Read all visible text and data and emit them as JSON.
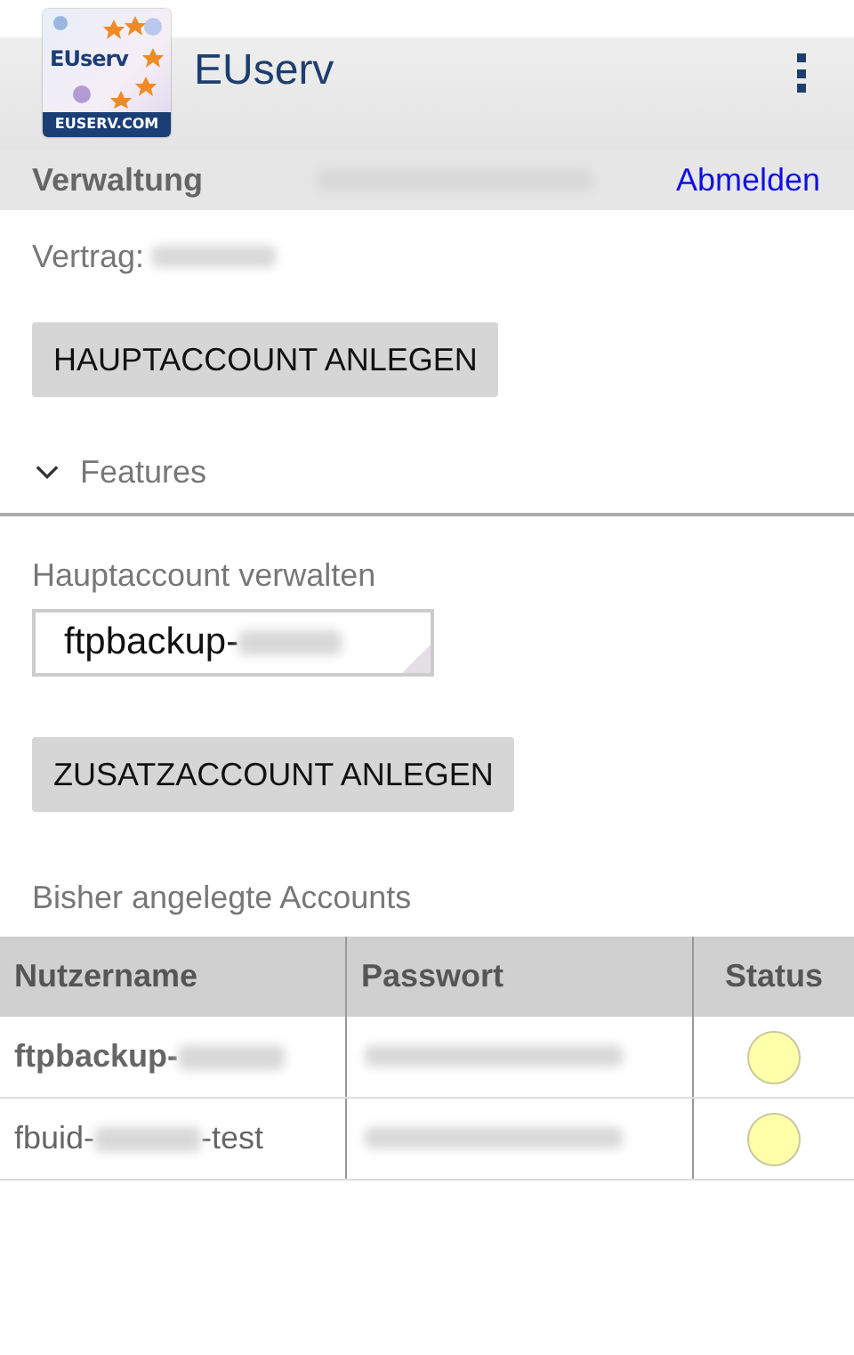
{
  "header": {
    "logo": {
      "brand": "EUserv",
      "domain": "EUSERV.COM"
    },
    "title": "EUserv"
  },
  "subbar": {
    "title": "Verwaltung",
    "user_redacted": true,
    "logout": "Abmelden"
  },
  "contract": {
    "label": "Vertrag:",
    "value_redacted": true
  },
  "create_main_button": "HAUPTACCOUNT ANLEGEN",
  "features": {
    "label": "Features",
    "expanded": false
  },
  "manage": {
    "label": "Hauptaccount verwalten",
    "value": "ftpbackup-",
    "value_redacted": true
  },
  "create_sub_button": "ZUSATZACCOUNT ANLEGEN",
  "accounts_heading": "Bisher angelegte Accounts",
  "table": {
    "columns": [
      "Nutzername",
      "Passwort",
      "Status"
    ],
    "rows": [
      {
        "kind": "main",
        "name_prefix": "ftpbackup-",
        "name_suffix": "",
        "password_redacted": true,
        "color": "#ffffaa"
      },
      {
        "kind": "sub",
        "name_prefix": "fbuid-",
        "name_suffix": "-test",
        "password_redacted": true,
        "color": "#ffffaa"
      }
    ]
  }
}
